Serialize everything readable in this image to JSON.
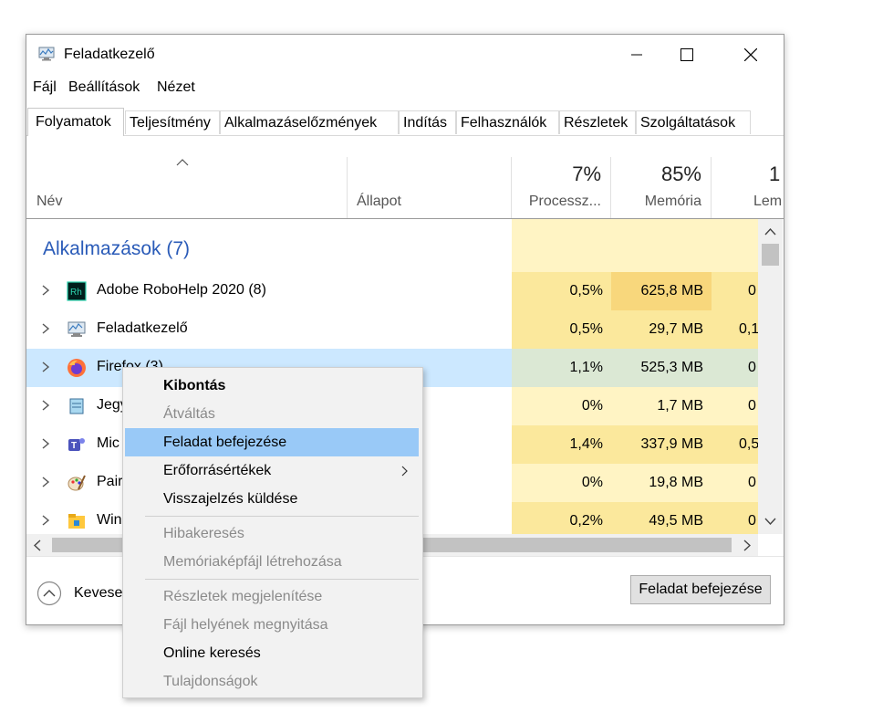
{
  "window": {
    "title": "Feladatkezelő",
    "minimize_icon": "minimize-icon",
    "maximize_icon": "maximize-icon",
    "close_icon": "close-icon"
  },
  "menu": [
    "Fájl",
    "Beállítások",
    "Nézet"
  ],
  "tabs": [
    "Folyamatok",
    "Teljesítmény",
    "Alkalmazáselőzmények",
    "Indítás",
    "Felhasználók",
    "Részletek",
    "Szolgáltatások"
  ],
  "header": {
    "name": "Név",
    "status": "Állapot",
    "cpu_pct": "7%",
    "cpu_label": "Processz...",
    "mem_pct": "85%",
    "mem_label": "Memória",
    "disk_pct": "1",
    "disk_label": "Lem"
  },
  "group": "Alkalmazások (7)",
  "rows": [
    {
      "name": "Adobe RoboHelp 2020 (8)",
      "cpu": "0,5%",
      "mem": "625,8 MB",
      "disk": "0",
      "icon": "robohelp-icon"
    },
    {
      "name": "Feladatkezelő",
      "cpu": "0,5%",
      "mem": "29,7 MB",
      "disk": "0,1",
      "icon": "task-manager-icon"
    },
    {
      "name": "Firefox (3)",
      "cpu": "1,1%",
      "mem": "525,3 MB",
      "disk": "0",
      "icon": "firefox-icon"
    },
    {
      "name": "Jegy",
      "cpu": "0%",
      "mem": "1,7 MB",
      "disk": "0",
      "icon": "notepad-icon"
    },
    {
      "name": "Mic",
      "cpu": "1,4%",
      "mem": "337,9 MB",
      "disk": "0,5",
      "icon": "teams-icon"
    },
    {
      "name": "Pair",
      "cpu": "0%",
      "mem": "19,8 MB",
      "disk": "0",
      "icon": "paint-icon"
    },
    {
      "name": "Win",
      "cpu": "0,2%",
      "mem": "49,5 MB",
      "disk": "0",
      "icon": "explorer-icon"
    }
  ],
  "footer": {
    "fewer": "Kevese",
    "end_task": "Feladat befejezése"
  },
  "context_menu": {
    "expand": "Kibontás",
    "switch": "Átváltás",
    "end_task": "Feladat befejezése",
    "resources": "Erőforrásértékek",
    "feedback": "Visszajelzés küldése",
    "debug": "Hibakeresés",
    "dump": "Memóriaképfájl létrehozása",
    "details": "Részletek megjelenítése",
    "open_location": "Fájl helyének megnyitása",
    "search_online": "Online keresés",
    "properties": "Tulajdonságok"
  },
  "colors": {
    "group_blue": "#2a5bb8",
    "heat_light": "#fff4c4",
    "heat_medium": "#fbe89c",
    "heat_strong": "#f8d77c",
    "selected_row": "#cce8ff",
    "menu_highlight": "#99c9f7"
  }
}
